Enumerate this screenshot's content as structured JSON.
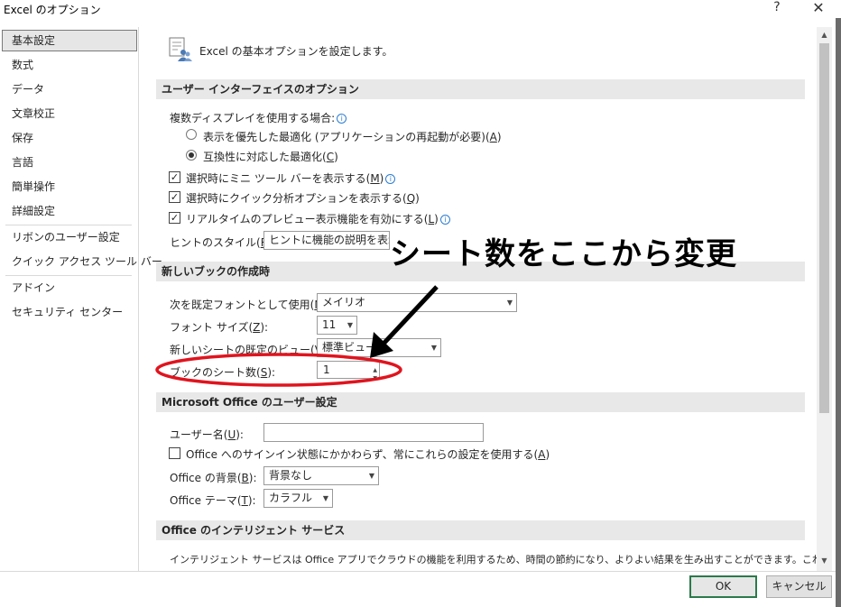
{
  "window": {
    "title": "Excel のオプション",
    "help": "?",
    "close": "✕"
  },
  "sidebar": {
    "items": [
      {
        "label": "基本設定",
        "selected": true
      },
      {
        "label": "数式"
      },
      {
        "label": "データ"
      },
      {
        "label": "文章校正"
      },
      {
        "label": "保存"
      },
      {
        "label": "言語"
      },
      {
        "label": "簡単操作"
      },
      {
        "label": "詳細設定"
      },
      {
        "label": "リボンのユーザー設定"
      },
      {
        "label": "クイック アクセス ツール バー"
      },
      {
        "label": "アドイン"
      },
      {
        "label": "セキュリティ センター"
      }
    ]
  },
  "header": {
    "text": "Excel の基本オプションを設定します。",
    "icon": "options-people-icon"
  },
  "ui_options": {
    "title": "ユーザー インターフェイスのオプション",
    "multi_display_label": "複数ディスプレイを使用する場合:",
    "radio_appearance": {
      "label": "表示を優先した最適化 (アプリケーションの再起動が必要)(",
      "key": "A",
      "end": ")",
      "checked": false
    },
    "radio_compat": {
      "label": "互換性に対応した最適化(",
      "key": "C",
      "end": ")",
      "checked": true
    },
    "check_minitoolbar": {
      "label": "選択時にミニ ツール バーを表示する(",
      "key": "M",
      "end": ")",
      "checked": true
    },
    "check_quickanalysis": {
      "label": "選択時にクイック分析オプションを表示する(",
      "key": "Q",
      "end": ")",
      "checked": true
    },
    "check_livepreview": {
      "label": "リアルタイムのプレビュー表示機能を有効にする(",
      "key": "L",
      "end": ")",
      "checked": true
    },
    "tooltip_label": "ヒントのスタイル(",
    "tooltip_key": "R",
    "tooltip_end": "):",
    "tooltip_value": "ヒントに機能の説明を表示す"
  },
  "new_book": {
    "title": "新しいブックの作成時",
    "font_label": "次を既定フォントとして使用(",
    "font_key": "N",
    "font_end": "):",
    "font_value": "メイリオ",
    "size_label": "フォント サイズ(",
    "size_key": "Z",
    "size_end": "):",
    "size_value": "11",
    "view_label": "新しいシートの既定のビュー(",
    "view_key": "V",
    "view_end": "):",
    "view_value": "標準ビュー",
    "sheets_label": "ブックのシート数(",
    "sheets_key": "S",
    "sheets_end": "):",
    "sheets_value": "1"
  },
  "ms_office": {
    "title": "Microsoft Office のユーザー設定",
    "username_label": "ユーザー名(",
    "username_key": "U",
    "username_end": "):",
    "username_value": "",
    "always_use_label": "Office へのサインイン状態にかかわらず、常にこれらの設定を使用する(",
    "always_use_key": "A",
    "always_use_end": ")",
    "always_use_checked": false,
    "bg_label": "Office の背景(",
    "bg_key": "B",
    "bg_end": "):",
    "bg_value": "背景なし",
    "theme_label": "Office テーマ(",
    "theme_key": "T",
    "theme_end": "):",
    "theme_value": "カラフル"
  },
  "intelligent": {
    "title": "Office のインテリジェント サービス",
    "description": "インテリジェント サービスは Office アプリでクラウドの機能を利用するため、時間の節約になり、よりよい結果を生み出すことができます。これらのサービスを"
  },
  "buttons": {
    "ok": "OK",
    "cancel": "キャンセル"
  },
  "annotation": {
    "text": "シート数をここから変更",
    "highlight_color": "#e0141e"
  },
  "colors": {
    "section_bg": "#e8e8e8",
    "ok_border": "#2a7a4a",
    "info_blue": "#2b7cd3"
  }
}
